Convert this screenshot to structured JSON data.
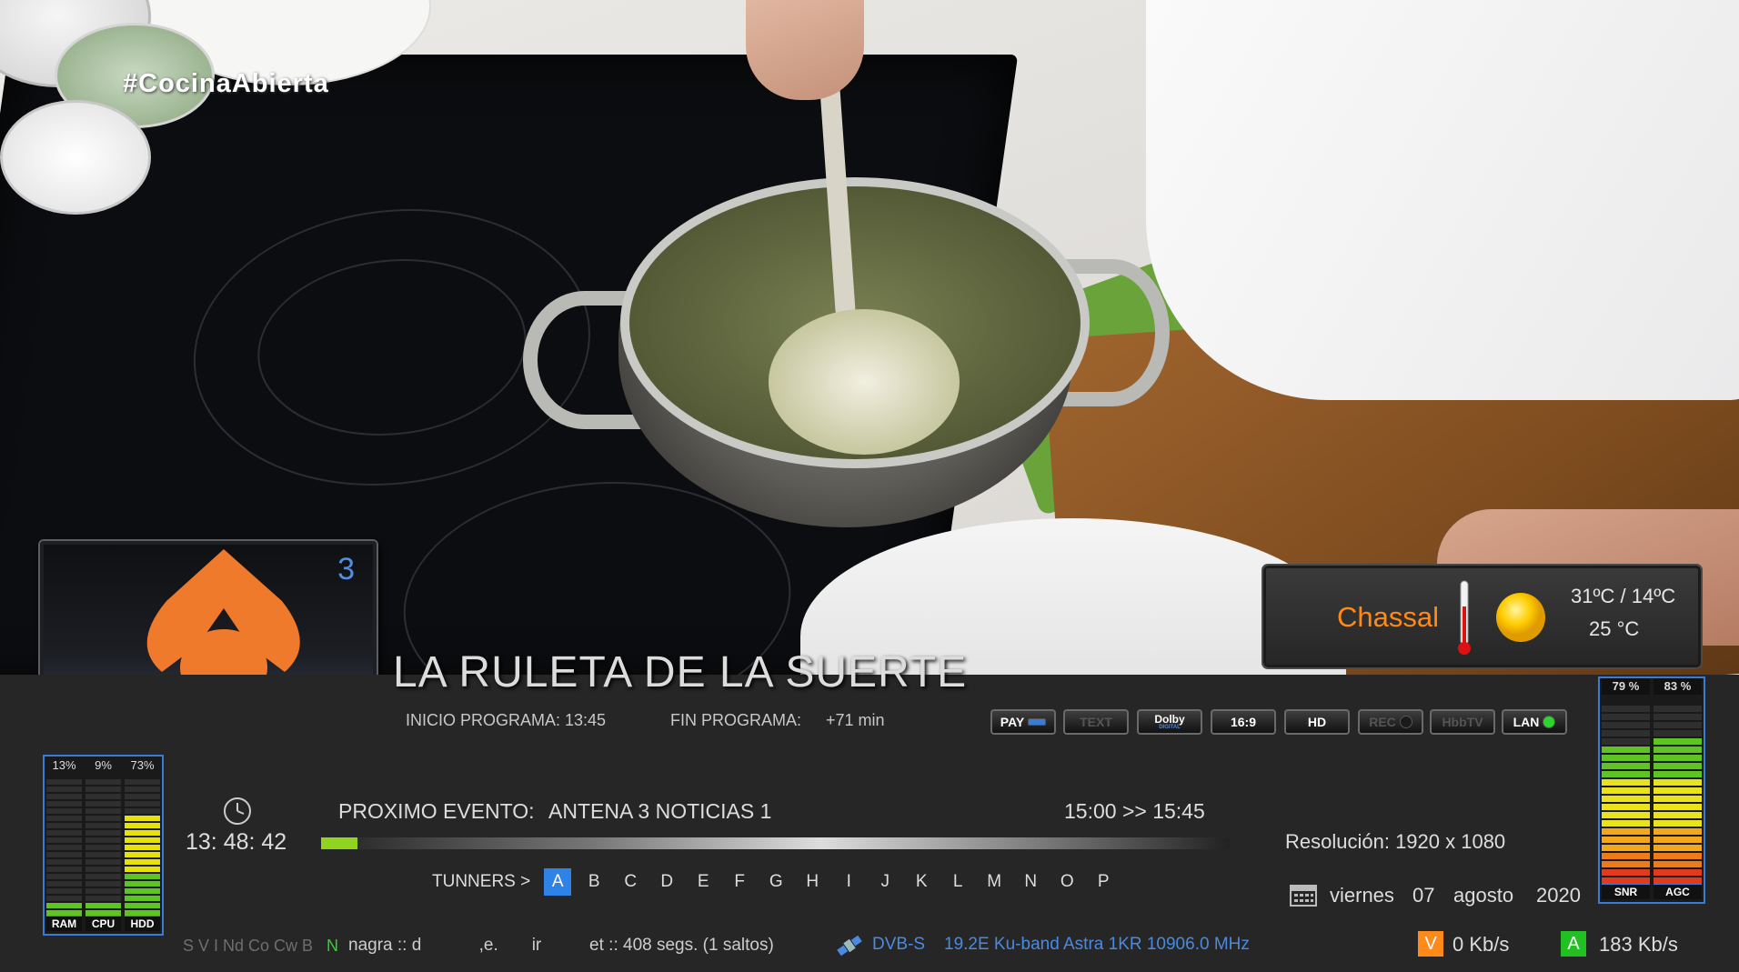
{
  "overlay": {
    "hashtag": "#CocinaAbierta"
  },
  "channel": {
    "number": "3",
    "logo_icon": "antena3-logo-icon"
  },
  "weather": {
    "city": "Chassal",
    "range": "31ºC / 14ºC",
    "current": "25 °C",
    "icons": [
      "thermometer-icon",
      "sun-icon"
    ]
  },
  "program": {
    "title": "LA RULETA DE LA SUERTE",
    "start_label": "INICIO PROGRAMA: 13:45",
    "end_label": "FIN PROGRAMA:",
    "end_value": "+71 min",
    "progress": 0.04
  },
  "next_event": {
    "label": "PROXIMO EVENTO:",
    "title": "ANTENA 3 NOTICIAS 1",
    "time": "15:00 >> 15:45"
  },
  "clock": {
    "time": "13: 48: 42",
    "icon": "clock-icon"
  },
  "flags": [
    {
      "label": "PAY",
      "active": true
    },
    {
      "label": "TEXT",
      "active": false
    },
    {
      "label": "Dolby",
      "sub": "DIGITAL",
      "active": true
    },
    {
      "label": "16:9",
      "active": true
    },
    {
      "label": "HD",
      "active": true
    },
    {
      "label": "REC",
      "active": false
    },
    {
      "label": "HbbTV",
      "active": false
    },
    {
      "label": "LAN",
      "active": true
    }
  ],
  "system_meters": [
    {
      "name": "RAM",
      "percent_label": "13%",
      "value": 13
    },
    {
      "name": "CPU",
      "percent_label": "9%",
      "value": 9
    },
    {
      "name": "HDD",
      "percent_label": "73%",
      "value": 73
    }
  ],
  "signal_meters": [
    {
      "name": "SNR",
      "percent_label": "79 %",
      "value": 79
    },
    {
      "name": "AGC",
      "percent_label": "83 %",
      "value": 83
    }
  ],
  "resolution": "Resolución: 1920 x 1080",
  "date": {
    "day": "viernes",
    "num": "07",
    "month": "agosto",
    "year": "2020",
    "icon": "calendar-icon"
  },
  "tuners": {
    "label": "TUNNERS >",
    "items": [
      "A",
      "B",
      "C",
      "D",
      "E",
      "F",
      "G",
      "H",
      "I",
      "J",
      "K",
      "L",
      "M",
      "N",
      "O",
      "P"
    ],
    "active": "A"
  },
  "ecm": {
    "grey": "S V I Nd Co Cw B",
    "green": "N",
    "text": "nagra :: d            ,e.       ir          et :: 408 segs. (1 saltos)"
  },
  "satellite": {
    "icon": "satellite-icon",
    "system": "DVB-S",
    "info": "19.2E Ku-band Astra 1KR 10906.0 MHz"
  },
  "bitrate": {
    "video_tag": "V",
    "video": "0 Kb/s",
    "audio_tag": "A",
    "audio": "183 Kb/s"
  },
  "colors": {
    "accent_blue": "#2f83e6",
    "orange": "#ff8a1a",
    "green": "#2cd62c",
    "progress": "#8fd41e"
  }
}
